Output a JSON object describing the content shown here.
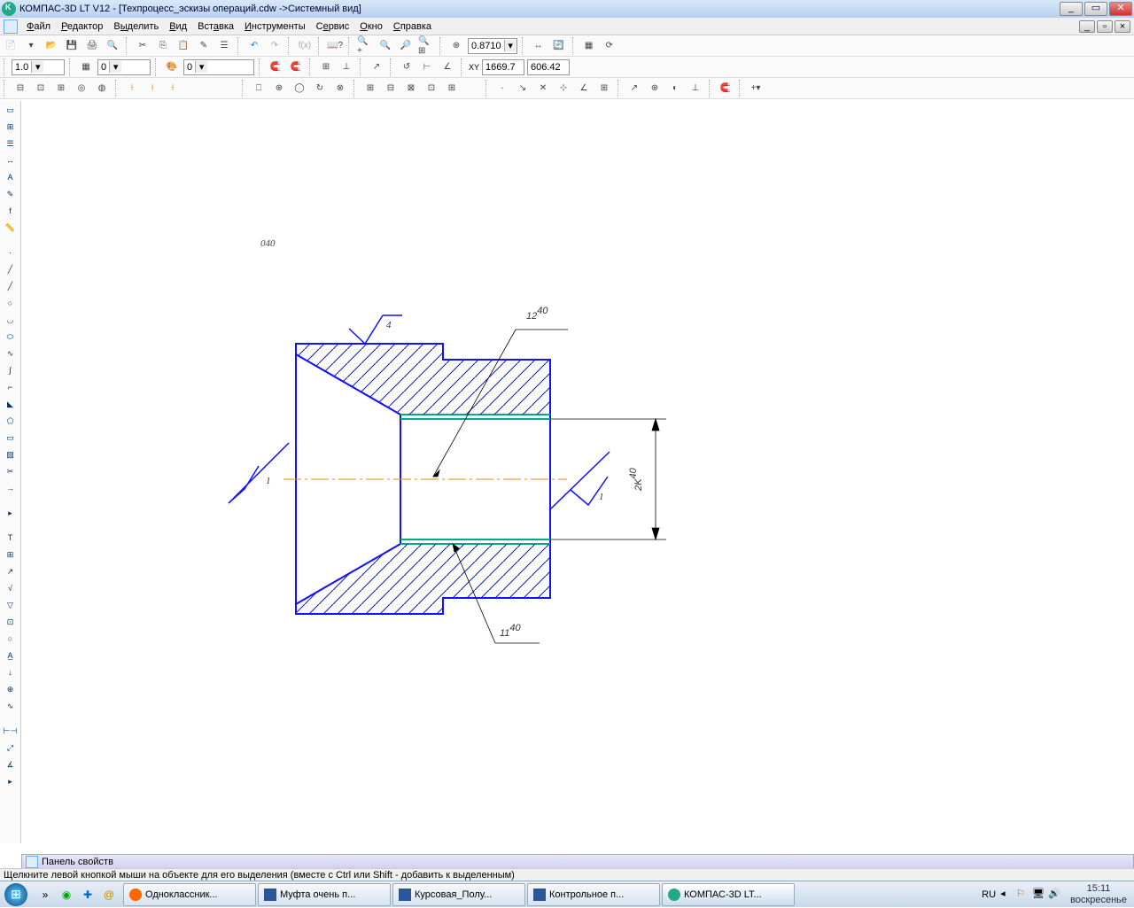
{
  "window": {
    "title": "КОМПАС-3D LT V12 - [Техпроцесс_эскизы операций.cdw ->Системный вид]",
    "min": "_",
    "max": "▭",
    "close": "✕"
  },
  "menu": {
    "file": "Файл",
    "edit": "Редактор",
    "select": "Выделить",
    "view": "Вид",
    "insert": "Вставка",
    "tools": "Инструменты",
    "service": "Сервис",
    "window": "Окно",
    "help": "Справка"
  },
  "toolbar": {
    "zoom": "0.8710",
    "step": "1.0",
    "layer_idx": "0",
    "layer_num": "0",
    "coord_x": "1669.7",
    "coord_y": "606.42"
  },
  "drawing": {
    "op_label": "040",
    "dim_top": "12",
    "dim_top_sup": "40",
    "dim_bottom": "11",
    "dim_bottom_sup": "40",
    "dim_right": "2K",
    "dim_right_sup": "40",
    "rough_top": "4",
    "rough_left": "1",
    "rough_right": "1"
  },
  "panel_props": "Панель свойств",
  "statusbar": "Щелкните левой кнопкой мыши на объекте для его выделения (вместе с Ctrl или Shift - добавить к выделенным)",
  "taskbar": {
    "tasks": [
      {
        "label": "Одноклассник...",
        "icon": "ff"
      },
      {
        "label": "Муфта очень п...",
        "icon": "word"
      },
      {
        "label": "Курсовая_Полу...",
        "icon": "word"
      },
      {
        "label": "Контрольное п...",
        "icon": "word"
      },
      {
        "label": "КОМПАС-3D LT...",
        "icon": "kompas"
      }
    ],
    "lang": "RU",
    "time": "15:11",
    "day": "воскресенье"
  }
}
